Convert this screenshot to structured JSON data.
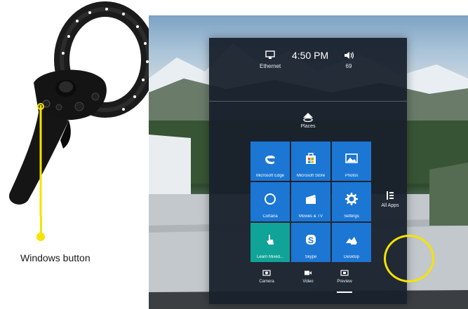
{
  "callout": {
    "label": "Windows button",
    "color": "#f5e300"
  },
  "status": {
    "network_label": "Ethernet",
    "time": "4:50 PM",
    "volume_label": "69"
  },
  "places": {
    "label": "Places"
  },
  "tiles": [
    {
      "label": "Microsoft Edge",
      "icon": "edge-icon"
    },
    {
      "label": "Microsoft Store",
      "icon": "store-icon"
    },
    {
      "label": "Photos",
      "icon": "photos-icon"
    },
    {
      "label": "Cortana",
      "icon": "cortana-icon"
    },
    {
      "label": "Movies & TV",
      "icon": "movies-icon"
    },
    {
      "label": "Settings",
      "icon": "gear-icon"
    },
    {
      "label": "Learn Mixed...",
      "icon": "learn-icon"
    },
    {
      "label": "Skype",
      "icon": "skype-icon"
    },
    {
      "label": "Desktop",
      "icon": "desktop-icon"
    }
  ],
  "all_apps": {
    "label": "All Apps"
  },
  "bottom_bar": {
    "items": [
      {
        "label": "Camera",
        "icon": "camera-icon"
      },
      {
        "label": "Video",
        "icon": "video-icon"
      },
      {
        "label": "Preview",
        "icon": "preview-icon",
        "active": true
      }
    ]
  },
  "colors": {
    "tile_blue": "#1c76d4",
    "tile_teal": "#10a397",
    "menu_bg": "#18212c"
  }
}
